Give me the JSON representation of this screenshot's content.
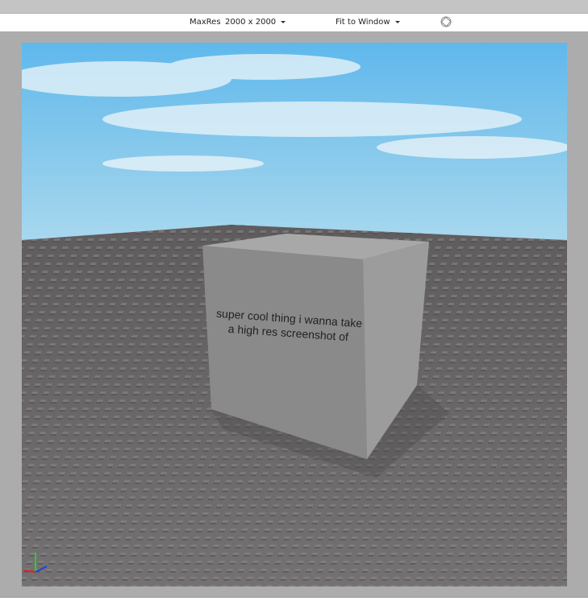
{
  "toolbar": {
    "maxres_label": "MaxRes",
    "resolution_value": "2000 x 2000",
    "fit_value": "Fit to Window",
    "rotate_icon": "rotate-icon"
  },
  "scene": {
    "cube_text": "super cool thing i wanna take a high res screenshot of",
    "sky_color": "#6fbfe8",
    "ground_color": "#6a6769"
  }
}
